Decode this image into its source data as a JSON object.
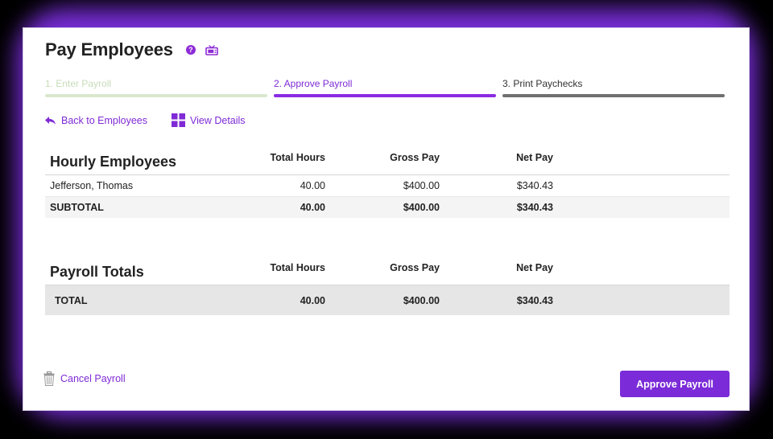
{
  "header": {
    "title": "Pay Employees"
  },
  "colors": {
    "accent": "#7b2bd8",
    "step_done": "#d9e8cd",
    "step_pending": "#6f6f6f"
  },
  "steps": [
    {
      "label": "1. Enter Payroll",
      "state": "done"
    },
    {
      "label": "2. Approve Payroll",
      "state": "active"
    },
    {
      "label": "3. Print Paychecks",
      "state": "pending"
    }
  ],
  "links": {
    "back": "Back to Employees",
    "details": "View Details"
  },
  "hourly": {
    "title": "Hourly Employees",
    "columns": [
      "Total Hours",
      "Gross Pay",
      "Net Pay"
    ],
    "rows": [
      {
        "name": "Jefferson, Thomas",
        "hours": "40.00",
        "gross": "$400.00",
        "net": "$340.43"
      }
    ],
    "subtotal": {
      "label": "SUBTOTAL",
      "hours": "40.00",
      "gross": "$400.00",
      "net": "$340.43"
    }
  },
  "totals": {
    "title": "Payroll Totals",
    "columns": [
      "Total Hours",
      "Gross Pay",
      "Net Pay"
    ],
    "total": {
      "label": "TOTAL",
      "hours": "40.00",
      "gross": "$400.00",
      "net": "$340.43"
    }
  },
  "actions": {
    "cancel": "Cancel Payroll",
    "approve": "Approve Payroll"
  }
}
